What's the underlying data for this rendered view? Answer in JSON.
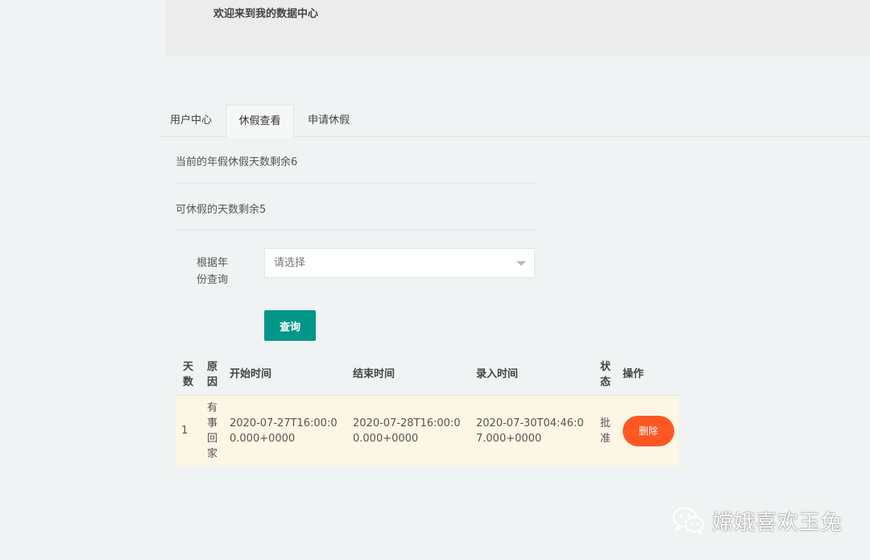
{
  "header": {
    "welcome": "欢迎来到我的数据中心"
  },
  "tabs": [
    {
      "label": "用户中心"
    },
    {
      "label": "休假查看"
    },
    {
      "label": "申请休假"
    }
  ],
  "info": {
    "annual_leave": "当前的年假休假天数剩余6",
    "available_days": "可休假的天数剩余5"
  },
  "form": {
    "year_label": "根据年份查询",
    "select_placeholder": "请选择",
    "query_button": "查询"
  },
  "table": {
    "columns": [
      "天数",
      "原因",
      "开始时间",
      "结束时间",
      "录入时间",
      "状态",
      "操作"
    ],
    "rows": [
      {
        "days": "1",
        "reason": "有事回家",
        "start": "2020-07-27T16:00:00.000+0000",
        "end": "2020-07-28T16:00:00.000+0000",
        "created": "2020-07-30T04:46:07.000+0000",
        "status": "批准",
        "action": "删除"
      }
    ]
  },
  "watermark": {
    "text": "嫦娥喜欢玉兔",
    "icon": "wechat-icon"
  }
}
